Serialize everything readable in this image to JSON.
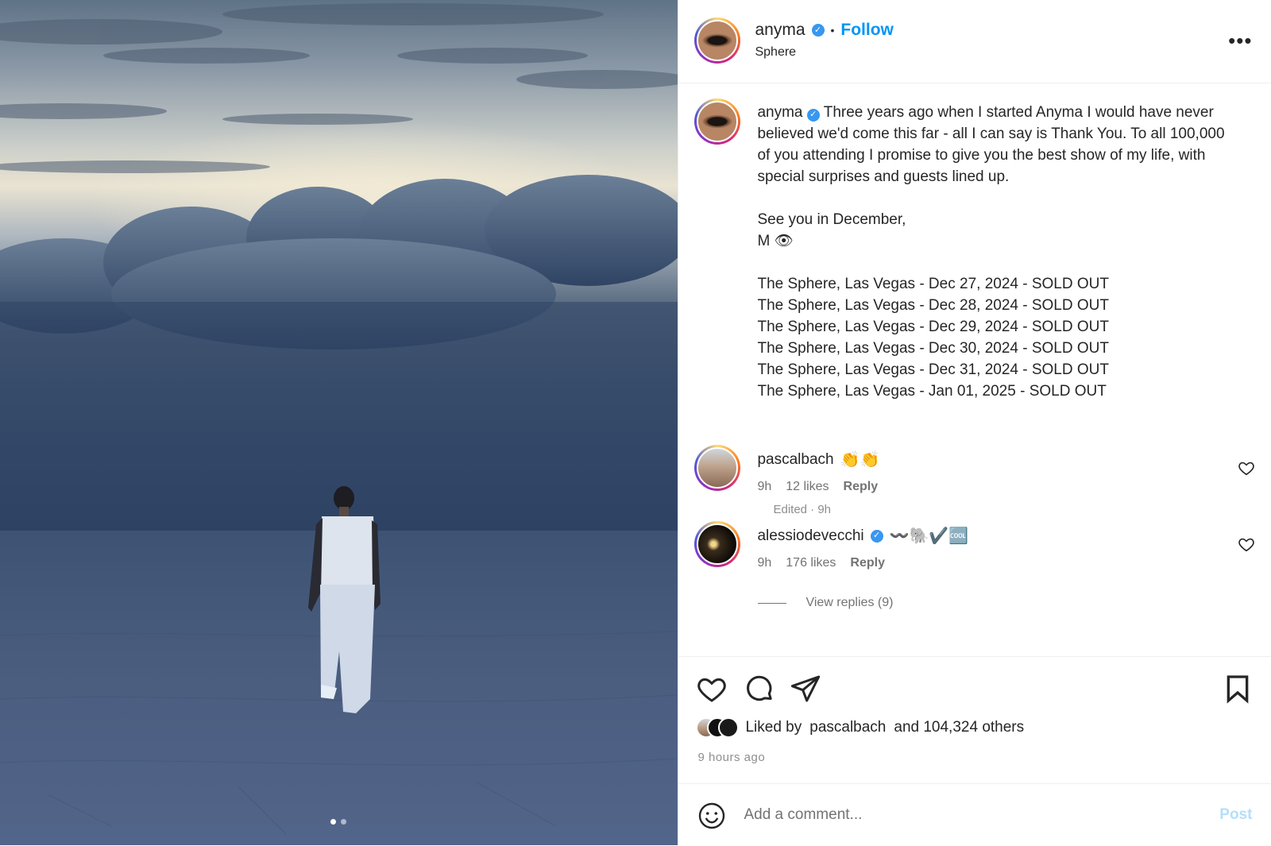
{
  "post": {
    "username": "anyma",
    "follow_label": "Follow",
    "location": "Sphere",
    "more_label": "•••",
    "caption": "Three years ago when I started Anyma I would have never believed we'd come this far - all I can say is Thank You. To all 100,000 of you attending I promise to give you the best show of my life, with special surprises and guests lined up.\n\nSee you in December,\nM 👁\n\nThe Sphere, Las Vegas - Dec 27, 2024 - SOLD OUT\nThe Sphere, Las Vegas - Dec 28, 2024 - SOLD OUT\nThe Sphere, Las Vegas - Dec 29, 2024 - SOLD OUT\nThe Sphere, Las Vegas - Dec 30, 2024 - SOLD OUT\nThe Sphere, Las Vegas - Dec 31, 2024 - SOLD OUT\nThe Sphere, Las Vegas - Jan 01, 2025 - SOLD OUT",
    "edited": "Edited · 9h"
  },
  "comments": [
    {
      "username": "pascalbach",
      "text": "👏👏",
      "time": "9h",
      "likes": "12 likes",
      "reply": "Reply"
    },
    {
      "username": "alessiodevecchi",
      "text": "〰️🐘✔️🆒",
      "time": "9h",
      "likes": "176 likes",
      "reply": "Reply"
    }
  ],
  "view_replies": "View replies (9)",
  "likes": {
    "liked_by_prefix": "Liked by",
    "liked_by_user": "pascalbach",
    "liked_by_suffix": "and 104,324 others",
    "time_ago": "9 hours ago"
  },
  "add_comment": {
    "placeholder": "Add a comment...",
    "post_label": "Post"
  },
  "carousel": {
    "count": 2,
    "active": 0
  },
  "colors": {
    "accent": "#0095f6",
    "verified": "#3897f0",
    "post_disabled": "#b2dffc"
  }
}
